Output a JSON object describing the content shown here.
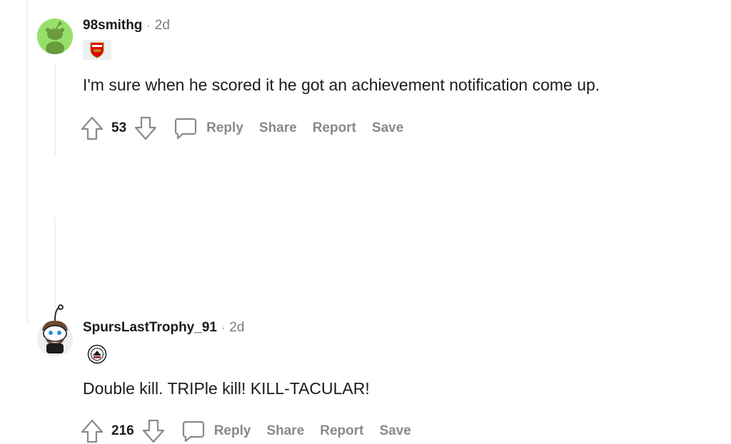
{
  "comments": [
    {
      "username": "98smithg",
      "separator": "·",
      "age": "2d",
      "flair_icon": "arsenal-crest-icon",
      "text": "I'm sure when he scored it he got an achievement notification come up.",
      "votes": "53",
      "actions": {
        "reply": "Reply",
        "share": "Share",
        "report": "Report",
        "save": "Save"
      }
    },
    {
      "username": "SpursLastTrophy_91",
      "separator": "·",
      "age": "2d",
      "flair_icon": "tottenham-badge-icon",
      "text": "Double kill. TRIPle kill! KILL-TACULAR!",
      "votes": "216",
      "actions": {
        "reply": "Reply",
        "share": "Share",
        "report": "Report",
        "save": "Save"
      }
    }
  ],
  "colors": {
    "meta_gray": "#7c7c7c",
    "action_gray": "#878a8c",
    "avatar_green": "#96e06a",
    "arsenal_red": "#db0007"
  }
}
